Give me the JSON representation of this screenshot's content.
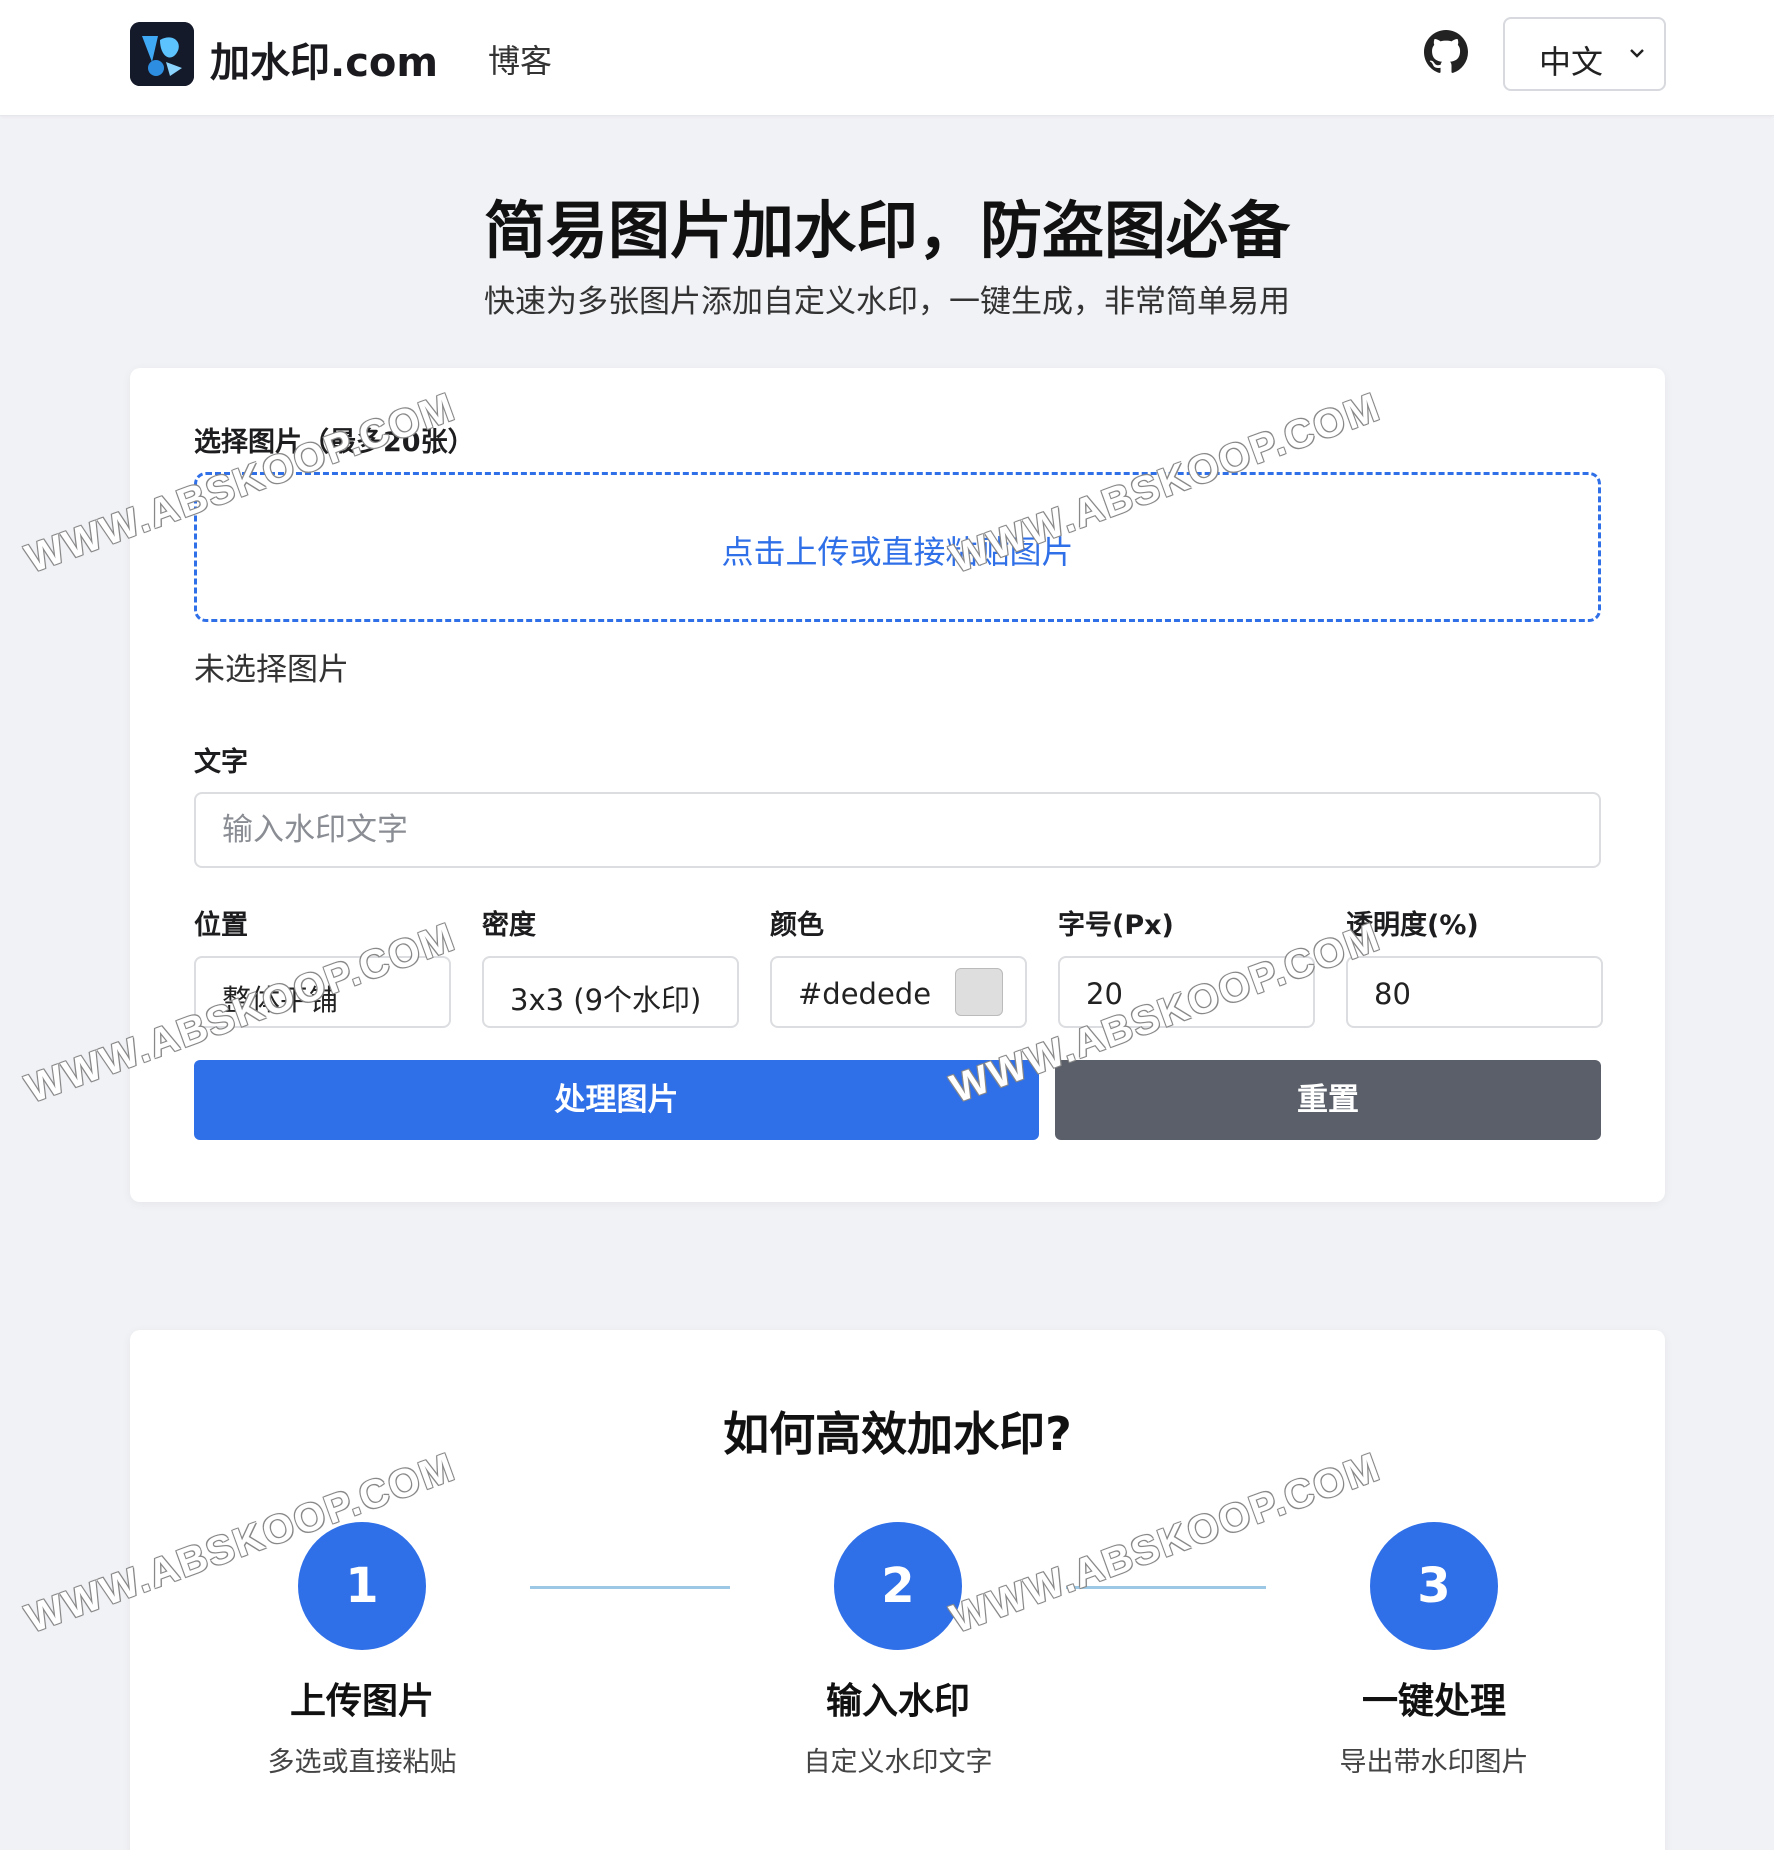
{
  "header": {
    "brand": "加水印.com",
    "nav_blog": "博客",
    "language": "中文"
  },
  "hero": {
    "title": "简易图片加水印，防盗图必备",
    "subtitle": "快速为多张图片添加自定义水印，一键生成，非常简单易用"
  },
  "form": {
    "images_label": "选择图片（最多20张）",
    "upload_hint": "点击上传或直接粘贴图片",
    "no_file": "未选择图片",
    "text_label": "文字",
    "text_placeholder": "输入水印文字",
    "position_label": "位置",
    "position_value": "整体平铺",
    "density_label": "密度",
    "density_value": "3x3 (9个水印)",
    "color_label": "颜色",
    "color_value": "#dedede",
    "font_size_label": "字号(Px)",
    "font_size_value": "20",
    "opacity_label": "透明度(%)",
    "opacity_value": "80",
    "process_button": "处理图片",
    "reset_button": "重置"
  },
  "steps": {
    "title": "如何高效加水印?",
    "items": [
      {
        "number": "1",
        "title": "上传图片",
        "desc": "多选或直接粘贴"
      },
      {
        "number": "2",
        "title": "输入水印",
        "desc": "自定义水印文字"
      },
      {
        "number": "3",
        "title": "一键处理",
        "desc": "导出带水印图片"
      }
    ]
  },
  "watermark_text": "WWW.ABSKOOP.COM",
  "colors": {
    "accent": "#2f6fe8",
    "reset": "#5a5f6a",
    "background": "#f1f2f6",
    "swatch": "#dedede",
    "connector": "#9cc8e6"
  },
  "icons": {
    "logo": "watermark-logo-icon",
    "github": "github-icon",
    "chevron": "chevron-down-icon"
  }
}
